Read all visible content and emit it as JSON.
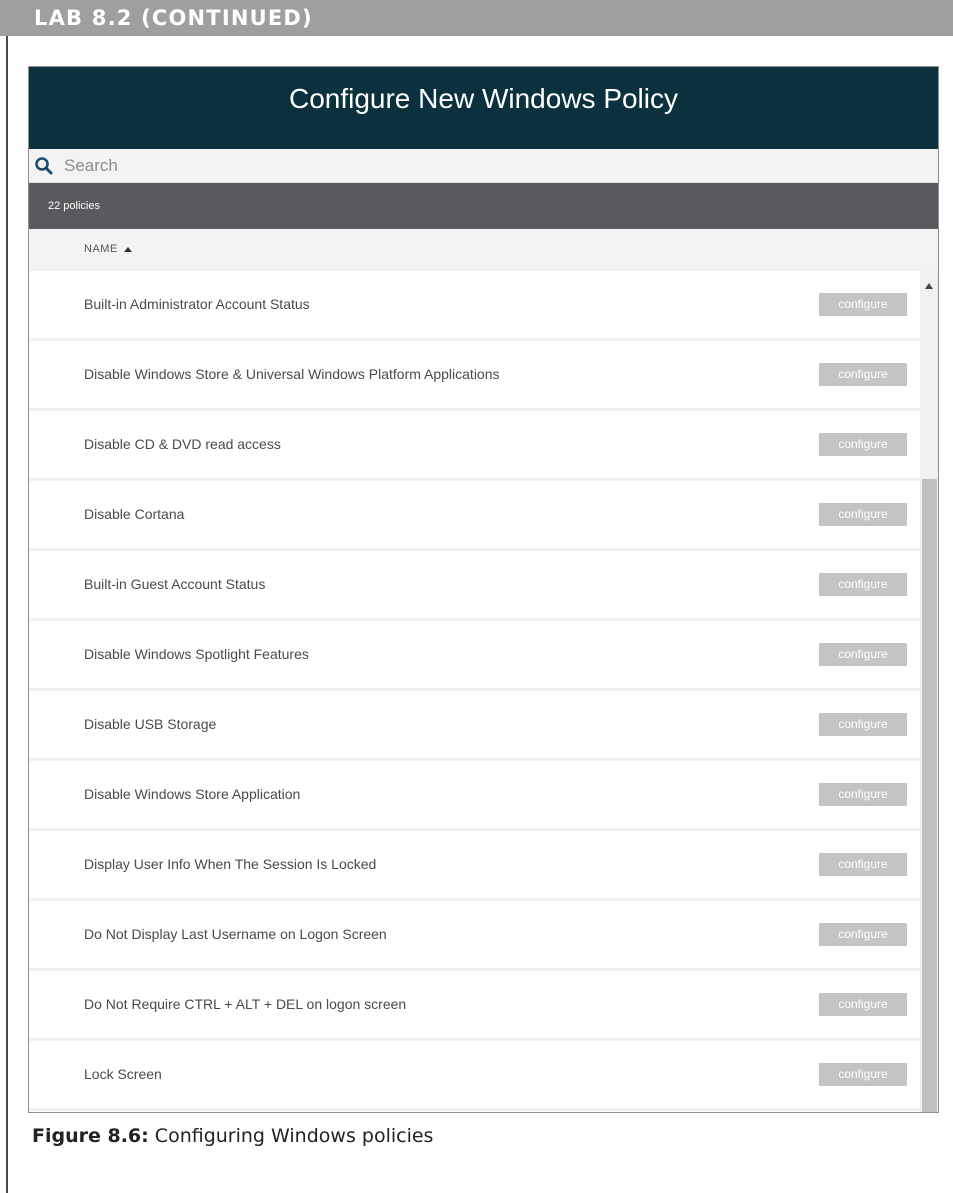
{
  "lab_header": "LAB 8.2 (CONTINUED)",
  "dialog": {
    "title": "Configure New Windows Policy",
    "search_placeholder": "Search",
    "count_label": "22 policies",
    "column_header": "NAME",
    "button_label": "configure",
    "policies": [
      "Built-in Administrator Account Status",
      "Disable Windows Store & Universal Windows Platform Applications",
      "Disable CD & DVD read access",
      "Disable Cortana",
      "Built-in Guest Account Status",
      "Disable Windows Spotlight Features",
      "Disable USB Storage",
      "Disable Windows Store Application",
      "Display User Info When The Session Is Locked",
      "Do Not Display Last Username on Logon Screen",
      "Do Not Require CTRL + ALT + DEL on logon screen",
      "Lock Screen"
    ]
  },
  "caption": {
    "label": "Figure 8.6:",
    "text": "Configuring Windows policies"
  },
  "colors": {
    "title_bar": "#0b313e",
    "count_bar": "#5a5a5e",
    "button": "#c4c4c4",
    "lab_header": "#9f9f9f"
  },
  "icons": [
    "search-icon",
    "sort-ascending-icon",
    "scroll-up-arrow-icon"
  ]
}
